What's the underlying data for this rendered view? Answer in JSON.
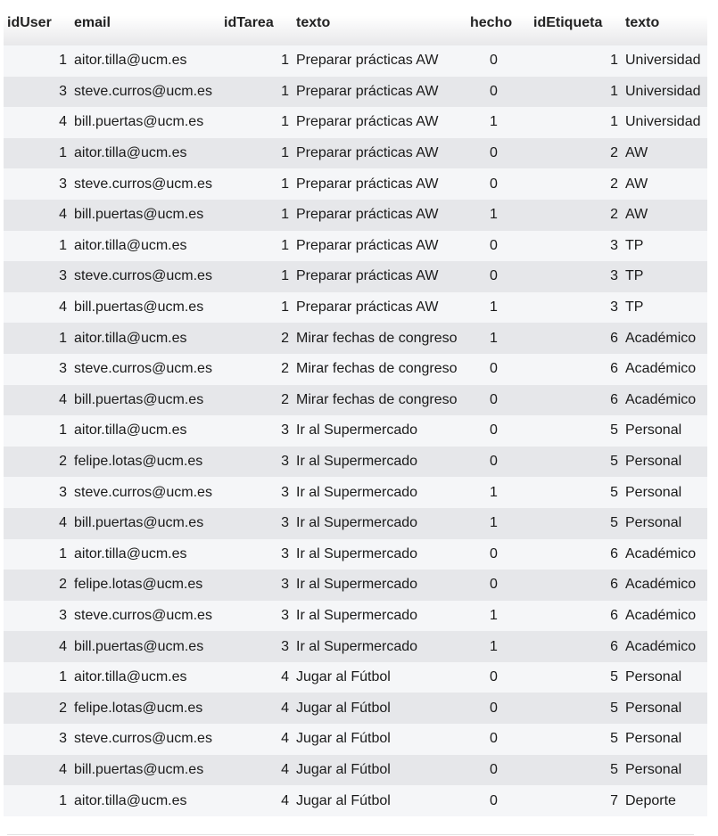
{
  "table": {
    "headers": [
      "idUser",
      "email",
      "idTarea",
      "texto",
      "hecho",
      "idEtiqueta",
      "texto"
    ],
    "rows": [
      [
        "1",
        "aitor.tilla@ucm.es",
        "1",
        "Preparar prácticas AW",
        "0",
        "1",
        "Universidad"
      ],
      [
        "3",
        "steve.curros@ucm.es",
        "1",
        "Preparar prácticas AW",
        "0",
        "1",
        "Universidad"
      ],
      [
        "4",
        "bill.puertas@ucm.es",
        "1",
        "Preparar prácticas AW",
        "1",
        "1",
        "Universidad"
      ],
      [
        "1",
        "aitor.tilla@ucm.es",
        "1",
        "Preparar prácticas AW",
        "0",
        "2",
        "AW"
      ],
      [
        "3",
        "steve.curros@ucm.es",
        "1",
        "Preparar prácticas AW",
        "0",
        "2",
        "AW"
      ],
      [
        "4",
        "bill.puertas@ucm.es",
        "1",
        "Preparar prácticas AW",
        "1",
        "2",
        "AW"
      ],
      [
        "1",
        "aitor.tilla@ucm.es",
        "1",
        "Preparar prácticas AW",
        "0",
        "3",
        "TP"
      ],
      [
        "3",
        "steve.curros@ucm.es",
        "1",
        "Preparar prácticas AW",
        "0",
        "3",
        "TP"
      ],
      [
        "4",
        "bill.puertas@ucm.es",
        "1",
        "Preparar prácticas AW",
        "1",
        "3",
        "TP"
      ],
      [
        "1",
        "aitor.tilla@ucm.es",
        "2",
        "Mirar fechas de congreso",
        "1",
        "6",
        "Académico"
      ],
      [
        "3",
        "steve.curros@ucm.es",
        "2",
        "Mirar fechas de congreso",
        "0",
        "6",
        "Académico"
      ],
      [
        "4",
        "bill.puertas@ucm.es",
        "2",
        "Mirar fechas de congreso",
        "0",
        "6",
        "Académico"
      ],
      [
        "1",
        "aitor.tilla@ucm.es",
        "3",
        "Ir al Supermercado",
        "0",
        "5",
        "Personal"
      ],
      [
        "2",
        "felipe.lotas@ucm.es",
        "3",
        "Ir al Supermercado",
        "0",
        "5",
        "Personal"
      ],
      [
        "3",
        "steve.curros@ucm.es",
        "3",
        "Ir al Supermercado",
        "1",
        "5",
        "Personal"
      ],
      [
        "4",
        "bill.puertas@ucm.es",
        "3",
        "Ir al Supermercado",
        "1",
        "5",
        "Personal"
      ],
      [
        "1",
        "aitor.tilla@ucm.es",
        "3",
        "Ir al Supermercado",
        "0",
        "6",
        "Académico"
      ],
      [
        "2",
        "felipe.lotas@ucm.es",
        "3",
        "Ir al Supermercado",
        "0",
        "6",
        "Académico"
      ],
      [
        "3",
        "steve.curros@ucm.es",
        "3",
        "Ir al Supermercado",
        "1",
        "6",
        "Académico"
      ],
      [
        "4",
        "bill.puertas@ucm.es",
        "3",
        "Ir al Supermercado",
        "1",
        "6",
        "Académico"
      ],
      [
        "1",
        "aitor.tilla@ucm.es",
        "4",
        "Jugar al Fútbol",
        "0",
        "5",
        "Personal"
      ],
      [
        "2",
        "felipe.lotas@ucm.es",
        "4",
        "Jugar al Fútbol",
        "0",
        "5",
        "Personal"
      ],
      [
        "3",
        "steve.curros@ucm.es",
        "4",
        "Jugar al Fútbol",
        "0",
        "5",
        "Personal"
      ],
      [
        "4",
        "bill.puertas@ucm.es",
        "4",
        "Jugar al Fútbol",
        "0",
        "5",
        "Personal"
      ],
      [
        "1",
        "aitor.tilla@ucm.es",
        "4",
        "Jugar al Fútbol",
        "0",
        "7",
        "Deporte"
      ]
    ]
  }
}
